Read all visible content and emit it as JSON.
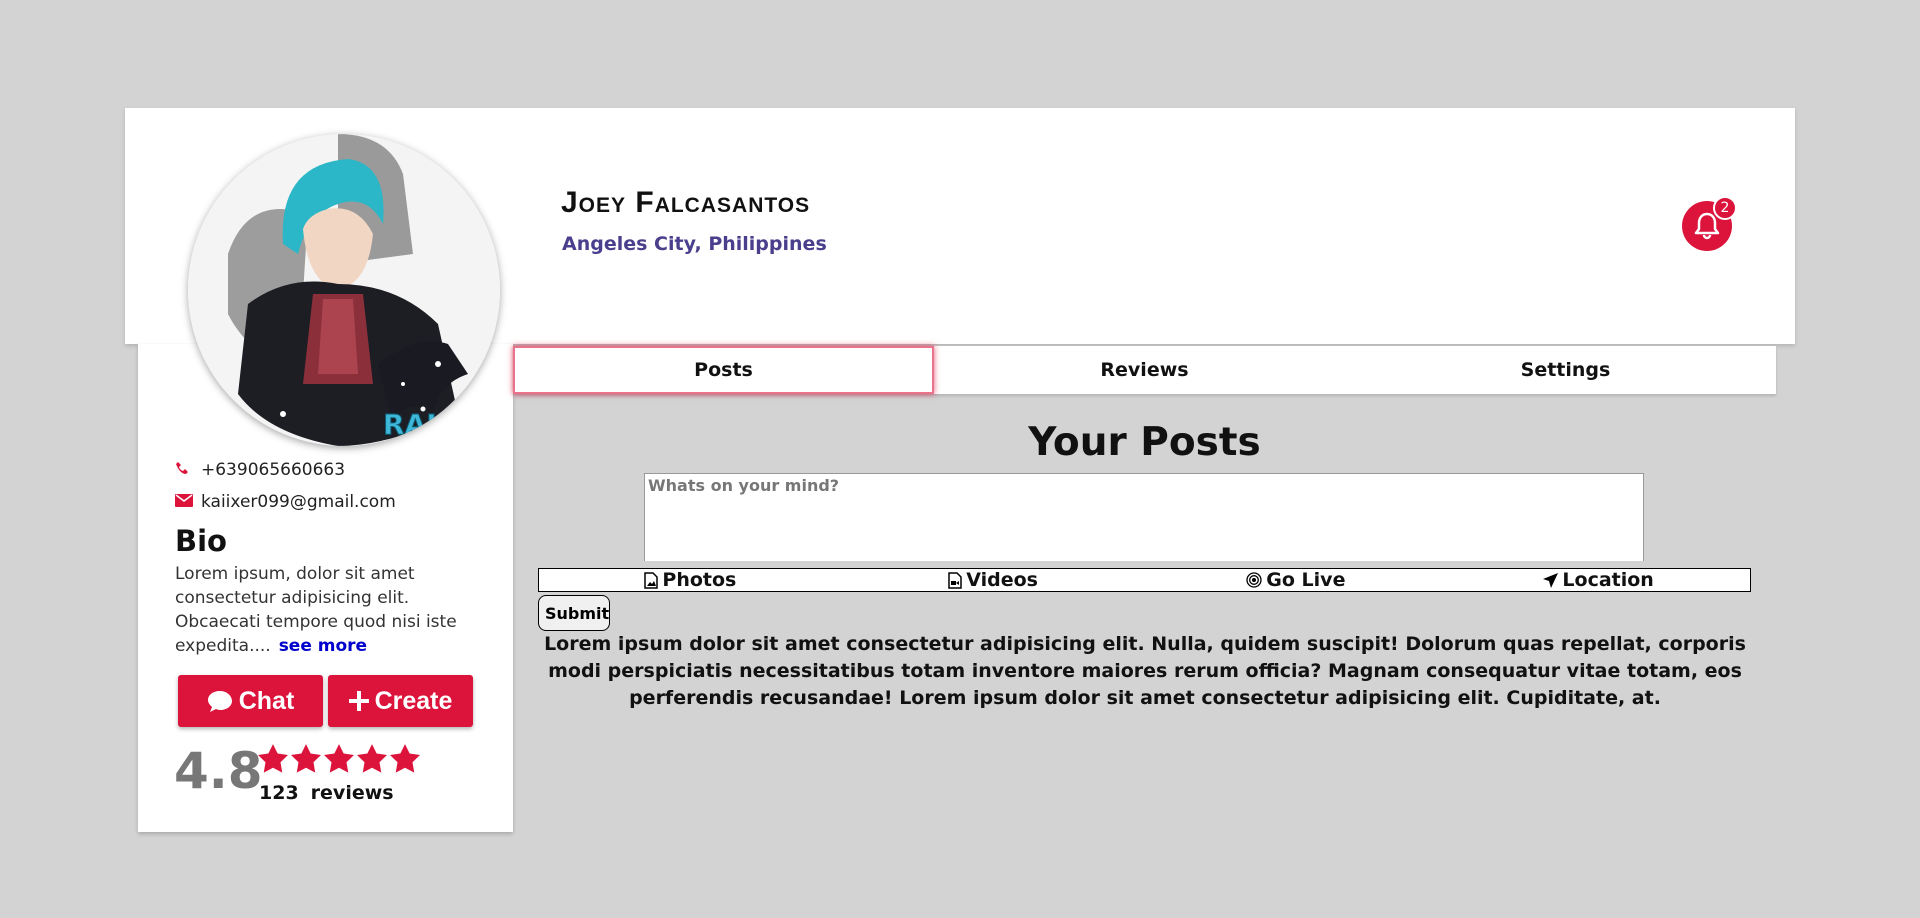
{
  "profile": {
    "name": "Joey Falcasantos",
    "location": "Angeles City, Philippines",
    "notification_count": "2"
  },
  "contact": {
    "phone": "+639065660663",
    "email": "kaiixer099@gmail.com"
  },
  "bio": {
    "title": "Bio",
    "text": "Lorem ipsum, dolor sit amet consectetur adipisicing elit. Obcaecati tempore quod nisi iste expedita....",
    "see_more": "see more"
  },
  "actions": {
    "chat": "Chat",
    "create": "Create"
  },
  "rating": {
    "score": "4.8",
    "stars": 5,
    "count": "123",
    "count_label": "reviews"
  },
  "tabs": [
    {
      "label": "Posts",
      "active": true
    },
    {
      "label": "Reviews",
      "active": false
    },
    {
      "label": "Settings",
      "active": false
    }
  ],
  "posts": {
    "title": "Your Posts",
    "placeholder": "Whats on your mind?",
    "media": [
      "Photos",
      "Videos",
      "Go Live",
      "Location"
    ],
    "submit": "Submit",
    "body": "Lorem ipsum dolor sit amet consectetur adipisicing elit. Nulla, quidem suscipit! Dolorum quas repellat, corporis modi perspiciatis necessitatibus totam inventore maiores rerum officia? Magnam consequatur vitae totam, eos perferendis recusandae! Lorem ipsum dolor sit amet consectetur adipisicing elit. Cupiditate, at."
  },
  "colors": {
    "accent": "#dc143c",
    "location_text": "#4a3f8c",
    "background": "#d3d3d3"
  }
}
